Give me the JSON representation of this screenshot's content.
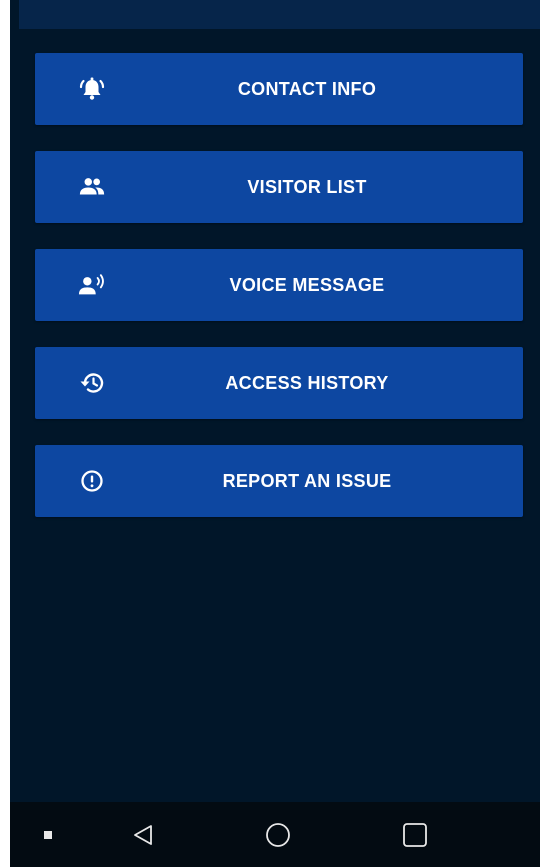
{
  "menu": {
    "items": [
      {
        "label": "CONTACT INFO",
        "icon": "alarm-bell-icon"
      },
      {
        "label": "VISITOR LIST",
        "icon": "people-icon"
      },
      {
        "label": "VOICE MESSAGE",
        "icon": "person-speaking-icon"
      },
      {
        "label": "ACCESS HISTORY",
        "icon": "history-icon"
      },
      {
        "label": "REPORT AN ISSUE",
        "icon": "exclamation-circle-icon"
      }
    ]
  },
  "navbar": {
    "items": [
      "square-dot-icon",
      "back-triangle-icon",
      "home-circle-icon",
      "recents-square-icon"
    ]
  },
  "colors": {
    "background": "#011629",
    "button": "#0d47a1",
    "top_bar": "#06254a",
    "nav_bar": "#030b12",
    "text": "#ffffff"
  }
}
